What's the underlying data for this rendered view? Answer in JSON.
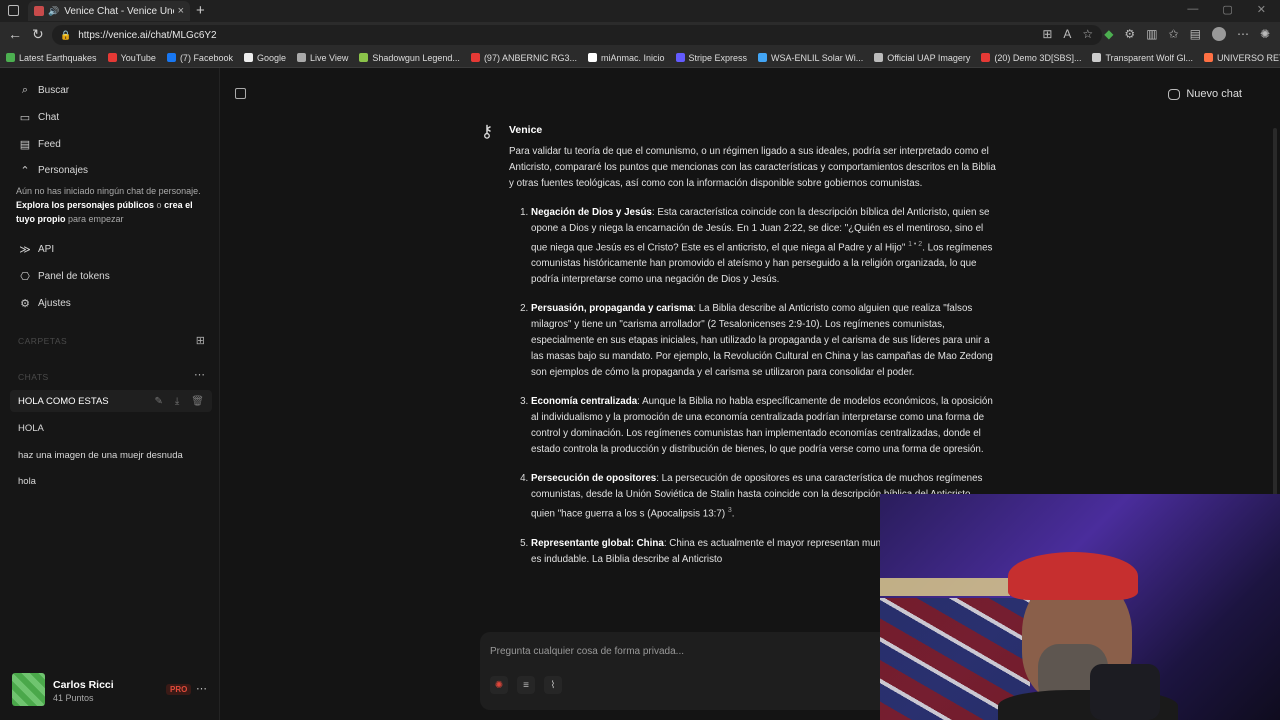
{
  "browser": {
    "tab_title": "Venice Chat - Venice Uncens...",
    "url": "https://venice.ai/chat/MLGc6Y2",
    "bookmarks": [
      {
        "label": "Latest Earthquakes",
        "color": "#4caf50"
      },
      {
        "label": "YouTube",
        "color": "#e53935"
      },
      {
        "label": "(7) Facebook",
        "color": "#1877f2"
      },
      {
        "label": "Google",
        "color": "#eeeeee"
      },
      {
        "label": "Live View",
        "color": "#aaaaaa"
      },
      {
        "label": "Shadowgun Legend...",
        "color": "#8bc34a"
      },
      {
        "label": "(97) ANBERNIC RG3...",
        "color": "#e53935"
      },
      {
        "label": "miAnmac. Inicio",
        "color": "#ffffff"
      },
      {
        "label": "Stripe Express",
        "color": "#635bff"
      },
      {
        "label": "WSA-ENLIL Solar Wi...",
        "color": "#42a5f5"
      },
      {
        "label": "Official UAP Imagery",
        "color": "#bbbbbb"
      },
      {
        "label": "(20) Demo 3D[SBS]...",
        "color": "#e53935"
      },
      {
        "label": "Transparent Wolf Gl...",
        "color": "#cccccc"
      },
      {
        "label": "UNIVERSO RETRO...",
        "color": "#ff7043"
      }
    ]
  },
  "sidebar": {
    "nav": [
      {
        "label": "Buscar",
        "icon": "search-icon"
      },
      {
        "label": "Chat",
        "icon": "chat-icon"
      },
      {
        "label": "Feed",
        "icon": "feed-icon"
      },
      {
        "label": "Personajes",
        "icon": "chevron-up-icon"
      }
    ],
    "persona_note": {
      "part1": "Aún no has iniciado ningún chat de personaje. ",
      "link1": "Explora los personajes públicos",
      "part2": " o ",
      "link2": "crea el tuyo propio",
      "part3": " para empezar"
    },
    "nav2": [
      {
        "label": "API",
        "icon": "api-icon"
      },
      {
        "label": "Panel de tokens",
        "icon": "token-panel-icon"
      },
      {
        "label": "Ajustes",
        "icon": "settings-icon"
      }
    ],
    "folders_label": "CARPETAS",
    "chats_label": "CHATS",
    "chats": [
      {
        "label": "HOLA COMO ESTAS"
      },
      {
        "label": "HOLA"
      },
      {
        "label": "haz una imagen de una muejr desnuda"
      },
      {
        "label": "hola"
      }
    ],
    "user": {
      "name": "Carlos Ricci",
      "points": "41 Puntos",
      "badge": "PRO"
    }
  },
  "header": {
    "new_chat": "Nuevo chat"
  },
  "message": {
    "author": "Venice",
    "intro": "Para validar tu teoría de que el comunismo, o un régimen ligado a sus ideales, podría ser interpretado como el Anticristo, compararé los puntos que mencionas con las características y comportamientos descritos en la Biblia y otras fuentes teológicas, así como con la información disponible sobre gobiernos comunistas.",
    "items": [
      {
        "title": "Negación de Dios y Jesús",
        "text": ": Esta característica coincide con la descripción bíblica del Anticristo, quien se opone a Dios y niega la encarnación de Jesús. En 1 Juan 2:22, se dice: \"¿Quién es el mentiroso, sino el que niega que Jesús es el Cristo? Este es el anticristo, el que niega al Padre y al Hijo\" ",
        "ref": "1 • 2",
        "text2": ". Los regímenes comunistas históricamente han promovido el ateísmo y han perseguido a la religión organizada, lo que podría interpretarse como una negación de Dios y Jesús."
      },
      {
        "title": "Persuasión, propaganda y carisma",
        "text": ": La Biblia describe al Anticristo como alguien que realiza \"falsos milagros\" y tiene un \"carisma arrollador\" (2 Tesalonicenses 2:9-10). Los regímenes comunistas, especialmente en sus etapas iniciales, han utilizado la propaganda y el carisma de sus líderes para unir a las masas bajo su mandato. Por ejemplo, la Revolución Cultural en China y las campañas de Mao Zedong son ejemplos de cómo la propaganda y el carisma se utilizaron para consolidar el poder.",
        "ref": "",
        "text2": ""
      },
      {
        "title": "Economía centralizada",
        "text": ": Aunque la Biblia no habla específicamente de modelos económicos, la oposición al individualismo y la promoción de una economía centralizada podrían interpretarse como una forma de control y dominación. Los regímenes comunistas han implementado economías centralizadas, donde el estado controla la producción y distribución de bienes, lo que podría verse como una forma de opresión.",
        "ref": "",
        "text2": ""
      },
      {
        "title": "Persecución de opositores",
        "text": ": La persecución de opositores es una característica de muchos regímenes comunistas, desde la Unión Soviética de Stalin hasta coincide con la descripción bíblica del Anticristo, quien \"hace guerra a los s (Apocalipsis 13:7) ",
        "ref": "3",
        "text2": "."
      },
      {
        "title": "Representante global: China",
        "text": ": China es actualmente el mayor representan mundo, y su influencia global es indudable. La Biblia describe al Anticristo",
        "ref": "",
        "text2": ""
      }
    ]
  },
  "composer": {
    "placeholder": "Pregunta cualquier cosa de forma privada..."
  }
}
